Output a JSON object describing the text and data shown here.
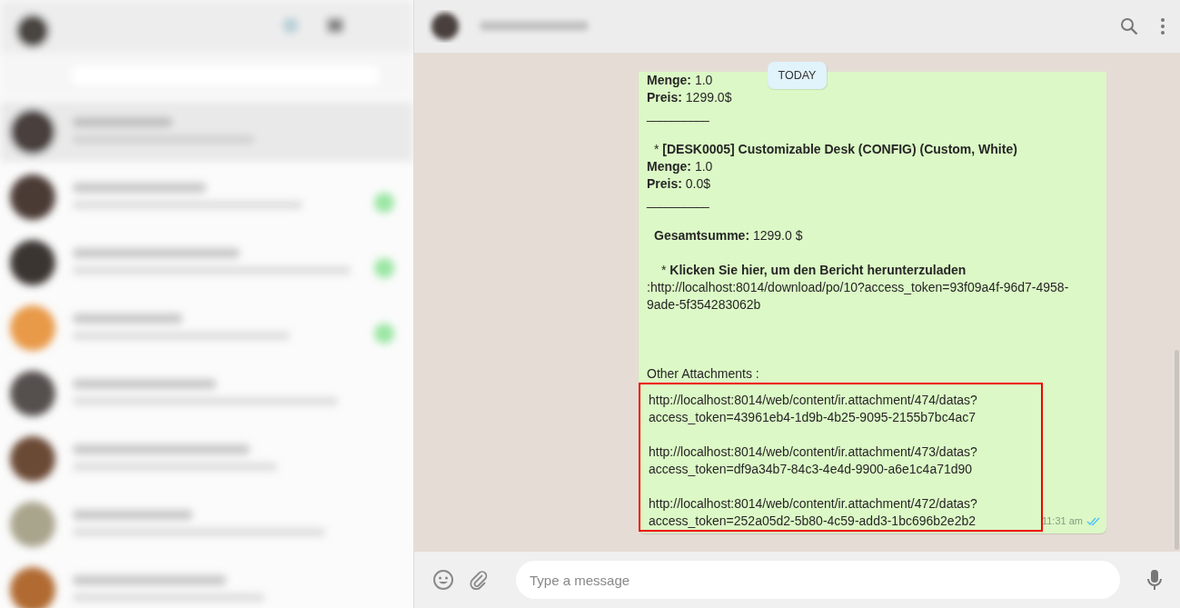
{
  "date_badge": "TODAY",
  "message": {
    "lines": [
      {
        "kind": "plain",
        "text": "**Menge:** 1.0"
      },
      {
        "kind": "plain",
        "text": "**Preis:** 1299.0$"
      },
      {
        "kind": "rule",
        "text": "__________"
      },
      {
        "kind": "blank"
      },
      {
        "kind": "indent",
        "text": "* **[DESK0005] Customizable Desk (CONFIG) (Custom, White)**"
      },
      {
        "kind": "plain",
        "text": "**Menge:** 1.0"
      },
      {
        "kind": "plain",
        "text": "**Preis:** 0.0$"
      },
      {
        "kind": "rule",
        "text": "__________"
      },
      {
        "kind": "blank"
      },
      {
        "kind": "indent",
        "text": "**Gesamtsumme:** 1299.0 $"
      },
      {
        "kind": "blank"
      },
      {
        "kind": "deep",
        "text": "* **Klicken Sie hier, um den Bericht herunterzuladen**"
      },
      {
        "kind": "plain",
        "text": ":http://localhost:8014/download/po/10?access_token=93f09a4f-96d7-4958-9ade-5f354283062b"
      },
      {
        "kind": "blank"
      },
      {
        "kind": "blank"
      },
      {
        "kind": "blank"
      },
      {
        "kind": "plain",
        "text": "Other Attachments :"
      }
    ],
    "attachments": [
      [
        "http://localhost:8014/web/content/ir.attachment/474/datas?",
        "access_token=43961eb4-1d9b-4b25-9095-2155b7bc4ac7"
      ],
      [
        "http://localhost:8014/web/content/ir.attachment/473/datas?",
        "access_token=df9a34b7-84c3-4e4d-9900-a6e1c4a71d90"
      ],
      [
        "http://localhost:8014/web/content/ir.attachment/472/datas?",
        "access_token=252a05d2-5b80-4c59-add3-1bc696b2e2b2"
      ]
    ],
    "attachments_highlighted": true,
    "time": "11:31 am",
    "read": true
  },
  "composer": {
    "placeholder": "Type a message"
  }
}
